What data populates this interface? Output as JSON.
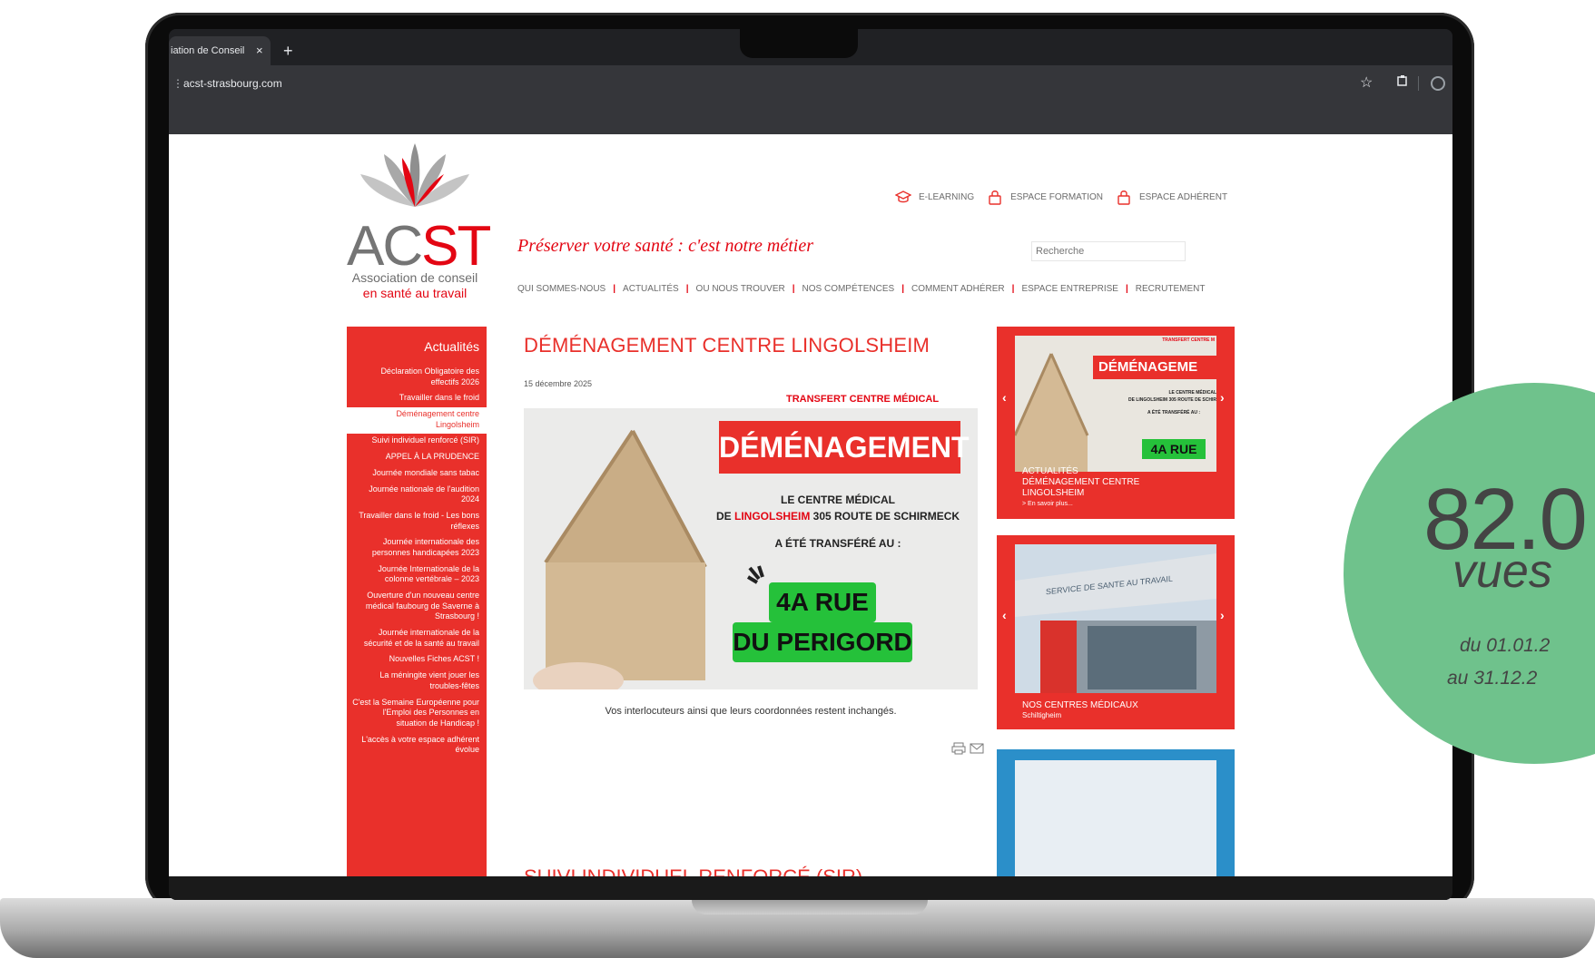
{
  "browser": {
    "tab_title": "iation de Conseil",
    "tab_close": "×",
    "new_tab": "+",
    "url": "acst-strasbourg.com",
    "info_icon": "⋮",
    "star_icon": "☆"
  },
  "site": {
    "logo": {
      "ac": "AC",
      "st": "ST",
      "sub1": "Association de conseil",
      "sub2": "en santé au travail"
    },
    "toplinks": [
      "E-LEARNING",
      "ESPACE FORMATION",
      "ESPACE ADHÉRENT"
    ],
    "tagline": "Préserver votre santé : c'est notre métier",
    "search_placeholder": "Recherche",
    "nav": [
      "QUI SOMMES-NOUS",
      "ACTUALITÉS",
      "OU NOUS TROUVER",
      "NOS COMPÉTENCES",
      "COMMENT ADHÉRER",
      "ESPACE ENTREPRISE",
      "RECRUTEMENT"
    ]
  },
  "sidebar": {
    "title": "Actualités",
    "items": [
      "Déclaration Obligatoire des effectifs 2026",
      "Travailler dans le froid",
      "Déménagement centre Lingolsheim",
      "Suivi individuel renforcé (SIR)",
      "APPEL À LA PRUDENCE",
      "Journée mondiale sans tabac",
      "Journée nationale de l'audition 2024",
      "Travailler dans le froid - Les bons réflexes",
      "Journée internationale des personnes handicapées 2023",
      "Journée Internationale de la colonne vertébrale – 2023",
      "Ouverture d'un nouveau centre médical faubourg de Saverne à Strasbourg !",
      "Journée internationale de la sécurité et de la santé au travail",
      "Nouvelles Fiches ACST !",
      "La méningite vient jouer les troubles-fêtes",
      "C'est la Semaine Européenne pour l'Emploi des Personnes en situation de Handicap !",
      "L'accès à votre espace adhérent évolue"
    ],
    "active_index": 2
  },
  "article": {
    "title": "DÉMÉNAGEMENT CENTRE LINGOLSHEIM",
    "date": "15 décembre 2025",
    "kicker": "TRANSFERT CENTRE MÉDICAL",
    "hero": {
      "banner": "DÉMÉNAGEMENT",
      "line1": "LE CENTRE MÉDICAL",
      "line2_prefix": "DE ",
      "line2_red": "LINGOLSHEIM",
      "line2_suffix": " 305 ROUTE DE SCHIRMECK",
      "line3": "A ÉTÉ TRANSFÉRÉ AU :",
      "green1": "4A RUE",
      "green2": "DU PERIGORD"
    },
    "footer": "Vos interlocuteurs ainsi que leurs coordonnées restent inchangés.",
    "next_title": "SUIVI INDIVIDUEL RENFORCÉ (SIR)"
  },
  "widgets": [
    {
      "mini_kicker": "TRANSFERT CENTRE M",
      "mini_banner": "DÉMÉNAGEME",
      "mini_line1": "LE CENTRE MÉDICAL",
      "mini_line2": "DE LINGOLSHEIM 305 ROUTE DE SCHIR",
      "mini_line3": "A ÉTÉ TRANSFÉRÉ AU :",
      "mini_green": "4A RUE",
      "cap1": "ACTUALITÉS",
      "cap2": "DÉMÉNAGEMENT CENTRE",
      "cap3": "LINGOLSHEIM",
      "cap4": "> En savoir plus..."
    },
    {
      "sign": "SERVICE DE SANTE AU TRAVAIL",
      "cap1": "NOS CENTRES MÉDICAUX",
      "cap2": "Schiltigheim"
    }
  ],
  "stats": {
    "number": "82.0",
    "label": "vues",
    "range1": "du 01.01.2",
    "range2": "au 31.12.2"
  },
  "colors": {
    "brand_red": "#e9302b",
    "text_red": "#e30613",
    "stat_green": "#6fc28c",
    "hero_green": "#25c13a"
  }
}
